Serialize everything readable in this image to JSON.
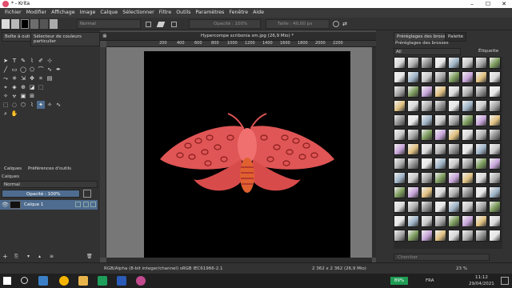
{
  "window": {
    "title": "* - Krita"
  },
  "menu": [
    "Fichier",
    "Modifier",
    "Affichage",
    "Image",
    "Calque",
    "Sélectionner",
    "Filtre",
    "Outils",
    "Paramètres",
    "Fenêtre",
    "Aide"
  ],
  "toolbar": {
    "blend_mode": "Normal",
    "opacity_label": "Opacité : 100%",
    "size_label": "Taille : 40,00 px"
  },
  "left_tabs": {
    "toolbox": "Boîte à outils",
    "color_selector": "Sélecteur de couleurs particulier"
  },
  "document": {
    "tab_title": "Hypercompe scribonia sm.jpg (26,9 Mio) *"
  },
  "ruler_ticks": [
    "200",
    "400",
    "600",
    "800",
    "1000",
    "1200",
    "1400",
    "1600",
    "1800",
    "2000",
    "2200"
  ],
  "layers_panel": {
    "tabs": [
      "Calques",
      "Préférences d'outils"
    ],
    "header": "Calques",
    "blend_mode": "Normal",
    "opacity": "Opacité : 100%",
    "layer_name": "Calque 1"
  },
  "right_panel": {
    "tabs": [
      "Préréglages des brosses",
      "Palette"
    ],
    "header": "Préréglages des brosses",
    "filter": "All",
    "tag_label": "Étiquette",
    "search_placeholder": "Chercher"
  },
  "status": {
    "color_info": "RGB/Alpha (8-bit integer/channel)  sRGB IEC61966-2.1",
    "dimensions": "2 362 x 2 362 (26,9 Mio)",
    "zoom": "23 %"
  },
  "taskbar": {
    "battery": "89%",
    "language": "FRA",
    "time": "11:12",
    "date": "29/04/2021"
  },
  "colors": {
    "accent": "#4e6c8f",
    "moth": "#e05555",
    "moth_light": "#f07070"
  }
}
